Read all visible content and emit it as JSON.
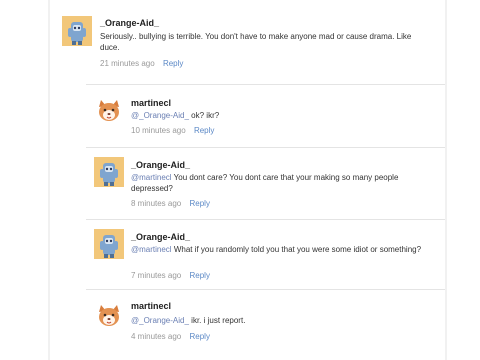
{
  "comments": [
    {
      "avatar": "orange-aid-avatar",
      "username": "_Orange-Aid_",
      "mention": "",
      "text": "Seriously.. bullying is terrible. You don't have to make anyone mad or cause drama. Like duce.",
      "time": "21 minutes ago",
      "reply": "Reply"
    },
    {
      "avatar": "martinecl-avatar",
      "username": "martinecl",
      "mention": "@_Orange-Aid_",
      "text": "ok? ikr?",
      "time": "10 minutes ago",
      "reply": "Reply"
    },
    {
      "avatar": "orange-aid-avatar",
      "username": "_Orange-Aid_",
      "mention": "@martinecl",
      "text": "You dont care? You dont care that your making so many people depressed?",
      "time": "8 minutes ago",
      "reply": "Reply"
    },
    {
      "avatar": "orange-aid-avatar",
      "username": "_Orange-Aid_",
      "mention": "@martinecl",
      "text": "What if you randomly told you that you were some idiot or something?",
      "time": "7 minutes ago",
      "reply": "Reply"
    },
    {
      "avatar": "martinecl-avatar",
      "username": "martinecl",
      "mention": "@_Orange-Aid_",
      "text": "ikr. i just report.",
      "time": "4 minutes ago",
      "reply": "Reply"
    }
  ]
}
